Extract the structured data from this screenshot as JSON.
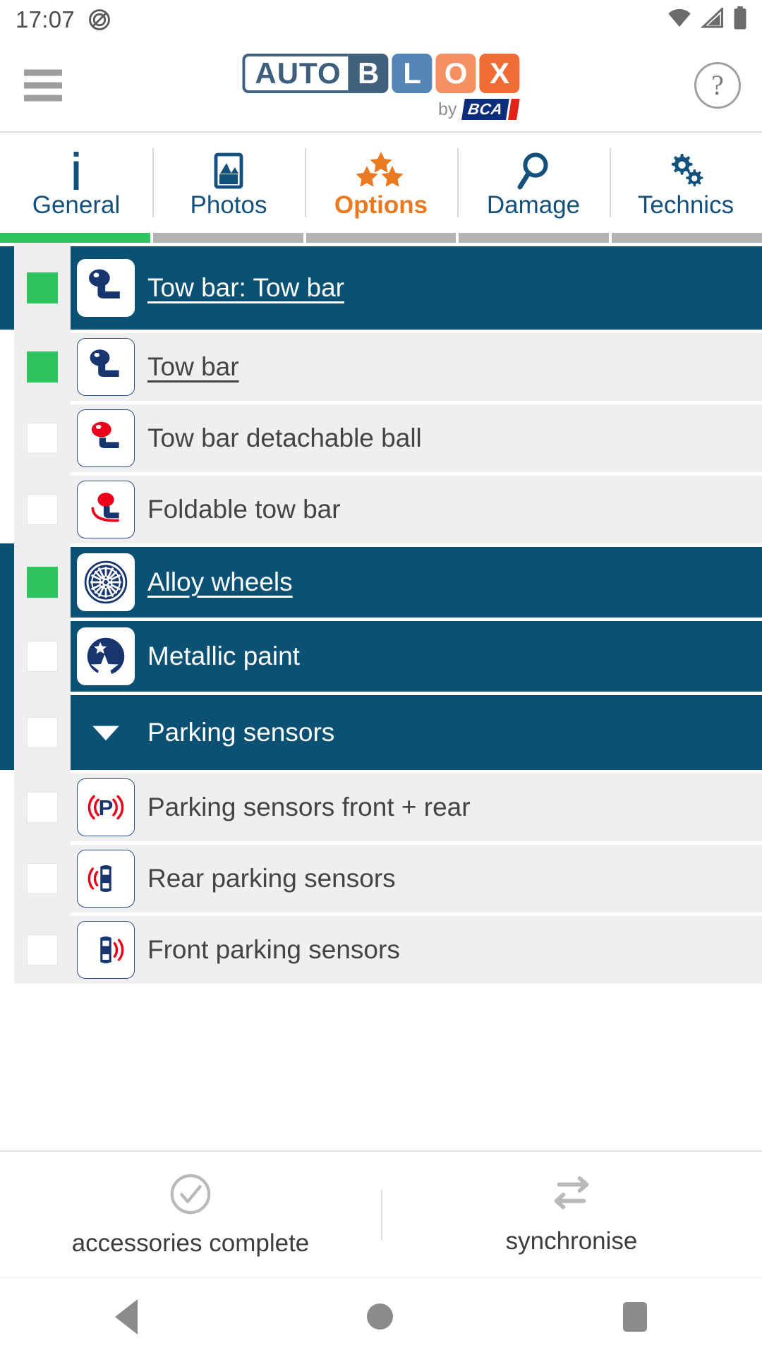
{
  "status_bar": {
    "time": "17:07",
    "icons": [
      "do-not-disturb-icon",
      "wifi-icon",
      "cellular-signal-icon",
      "battery-icon"
    ]
  },
  "header": {
    "menu_icon": "hamburger-menu-icon",
    "help_icon": "help-question-icon",
    "help_glyph": "?",
    "logo": {
      "plate_text": "AUTO",
      "block_b": "B",
      "block_l": "L",
      "block_o": "O",
      "block_x": "X",
      "by_text": "by",
      "bca_text": "BCA"
    },
    "colors": {
      "plate_border": "#40617d",
      "block_b": "#40617d",
      "block_l": "#5585b5",
      "block_o": "#f59063",
      "block_x": "#ef6c35",
      "bca_blue": "#0b2d7a",
      "bca_red": "#e2231a"
    }
  },
  "tabs": [
    {
      "label": "General",
      "icon": "info-icon",
      "active": false,
      "progress": "done"
    },
    {
      "label": "Photos",
      "icon": "photo-icon",
      "active": false,
      "progress": "todo"
    },
    {
      "label": "Options",
      "icon": "stars-icon",
      "active": true,
      "progress": "todo"
    },
    {
      "label": "Damage",
      "icon": "magnifier-icon",
      "active": false,
      "progress": "todo"
    },
    {
      "label": "Technics",
      "icon": "gears-icon",
      "active": false,
      "progress": "todo"
    }
  ],
  "theme": {
    "tab_blue": "#12517d",
    "accent_orange": "#ea7a22",
    "row_header_blue": "#0b5174",
    "checked_green": "#2ec45f",
    "row_bg": "#efefef"
  },
  "options_list": [
    {
      "label": "Tow bar: Tow bar",
      "type": "group",
      "icon": "tow-bar-icon",
      "checked": true,
      "linked": true
    },
    {
      "label": "Tow bar",
      "type": "child",
      "icon": "tow-bar-icon",
      "checked": true,
      "linked": true
    },
    {
      "label": "Tow bar detachable ball",
      "type": "child",
      "icon": "tow-bar-detachable-icon",
      "checked": false,
      "linked": false
    },
    {
      "label": "Foldable tow bar",
      "type": "child",
      "icon": "foldable-tow-bar-icon",
      "checked": false,
      "linked": false
    },
    {
      "label": "Alloy wheels",
      "type": "group",
      "icon": "alloy-wheel-icon",
      "checked": true,
      "linked": true
    },
    {
      "label": "Metallic paint",
      "type": "group",
      "icon": "metallic-paint-star-icon",
      "checked": false,
      "linked": false
    },
    {
      "label": "Parking sensors",
      "type": "group",
      "icon": "chevron-down-icon",
      "checked": false,
      "linked": false,
      "collapsible": true
    },
    {
      "label": "Parking sensors front + rear",
      "type": "child",
      "icon": "parking-sensor-p-icon",
      "checked": false,
      "linked": false
    },
    {
      "label": "Rear parking sensors",
      "type": "child",
      "icon": "rear-parking-sensor-icon",
      "checked": false,
      "linked": false
    },
    {
      "label": "Front parking sensors",
      "type": "child",
      "icon": "front-parking-sensor-icon",
      "checked": false,
      "linked": false
    }
  ],
  "action_bar": [
    {
      "label": "accessories complete",
      "icon": "check-circle-icon"
    },
    {
      "label": "synchronise",
      "icon": "sync-arrows-icon"
    }
  ],
  "nav_bar": [
    {
      "icon": "back-triangle-icon"
    },
    {
      "icon": "home-circle-icon"
    },
    {
      "icon": "recents-square-icon"
    }
  ]
}
